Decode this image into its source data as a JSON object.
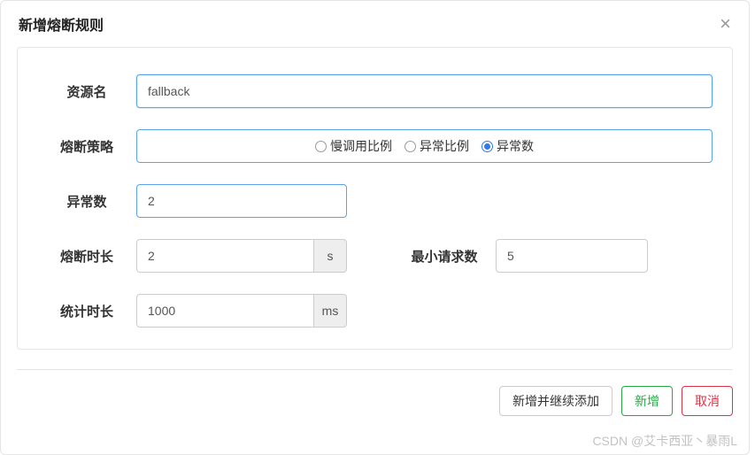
{
  "modal": {
    "title": "新增熔断规则",
    "close_label": "×"
  },
  "form": {
    "resource": {
      "label": "资源名",
      "value": "fallback"
    },
    "strategy": {
      "label": "熔断策略",
      "options": [
        {
          "label": "慢调用比例",
          "checked": false
        },
        {
          "label": "异常比例",
          "checked": false
        },
        {
          "label": "异常数",
          "checked": true
        }
      ]
    },
    "exception_count": {
      "label": "异常数",
      "value": "2"
    },
    "break_duration": {
      "label": "熔断时长",
      "value": "2",
      "unit": "s"
    },
    "min_requests": {
      "label": "最小请求数",
      "value": "5"
    },
    "stat_duration": {
      "label": "统计时长",
      "value": "1000",
      "unit": "ms"
    }
  },
  "footer": {
    "add_continue": "新增并继续添加",
    "add": "新增",
    "cancel": "取消"
  },
  "watermark": "CSDN @艾卡西亚丶暴雨L"
}
